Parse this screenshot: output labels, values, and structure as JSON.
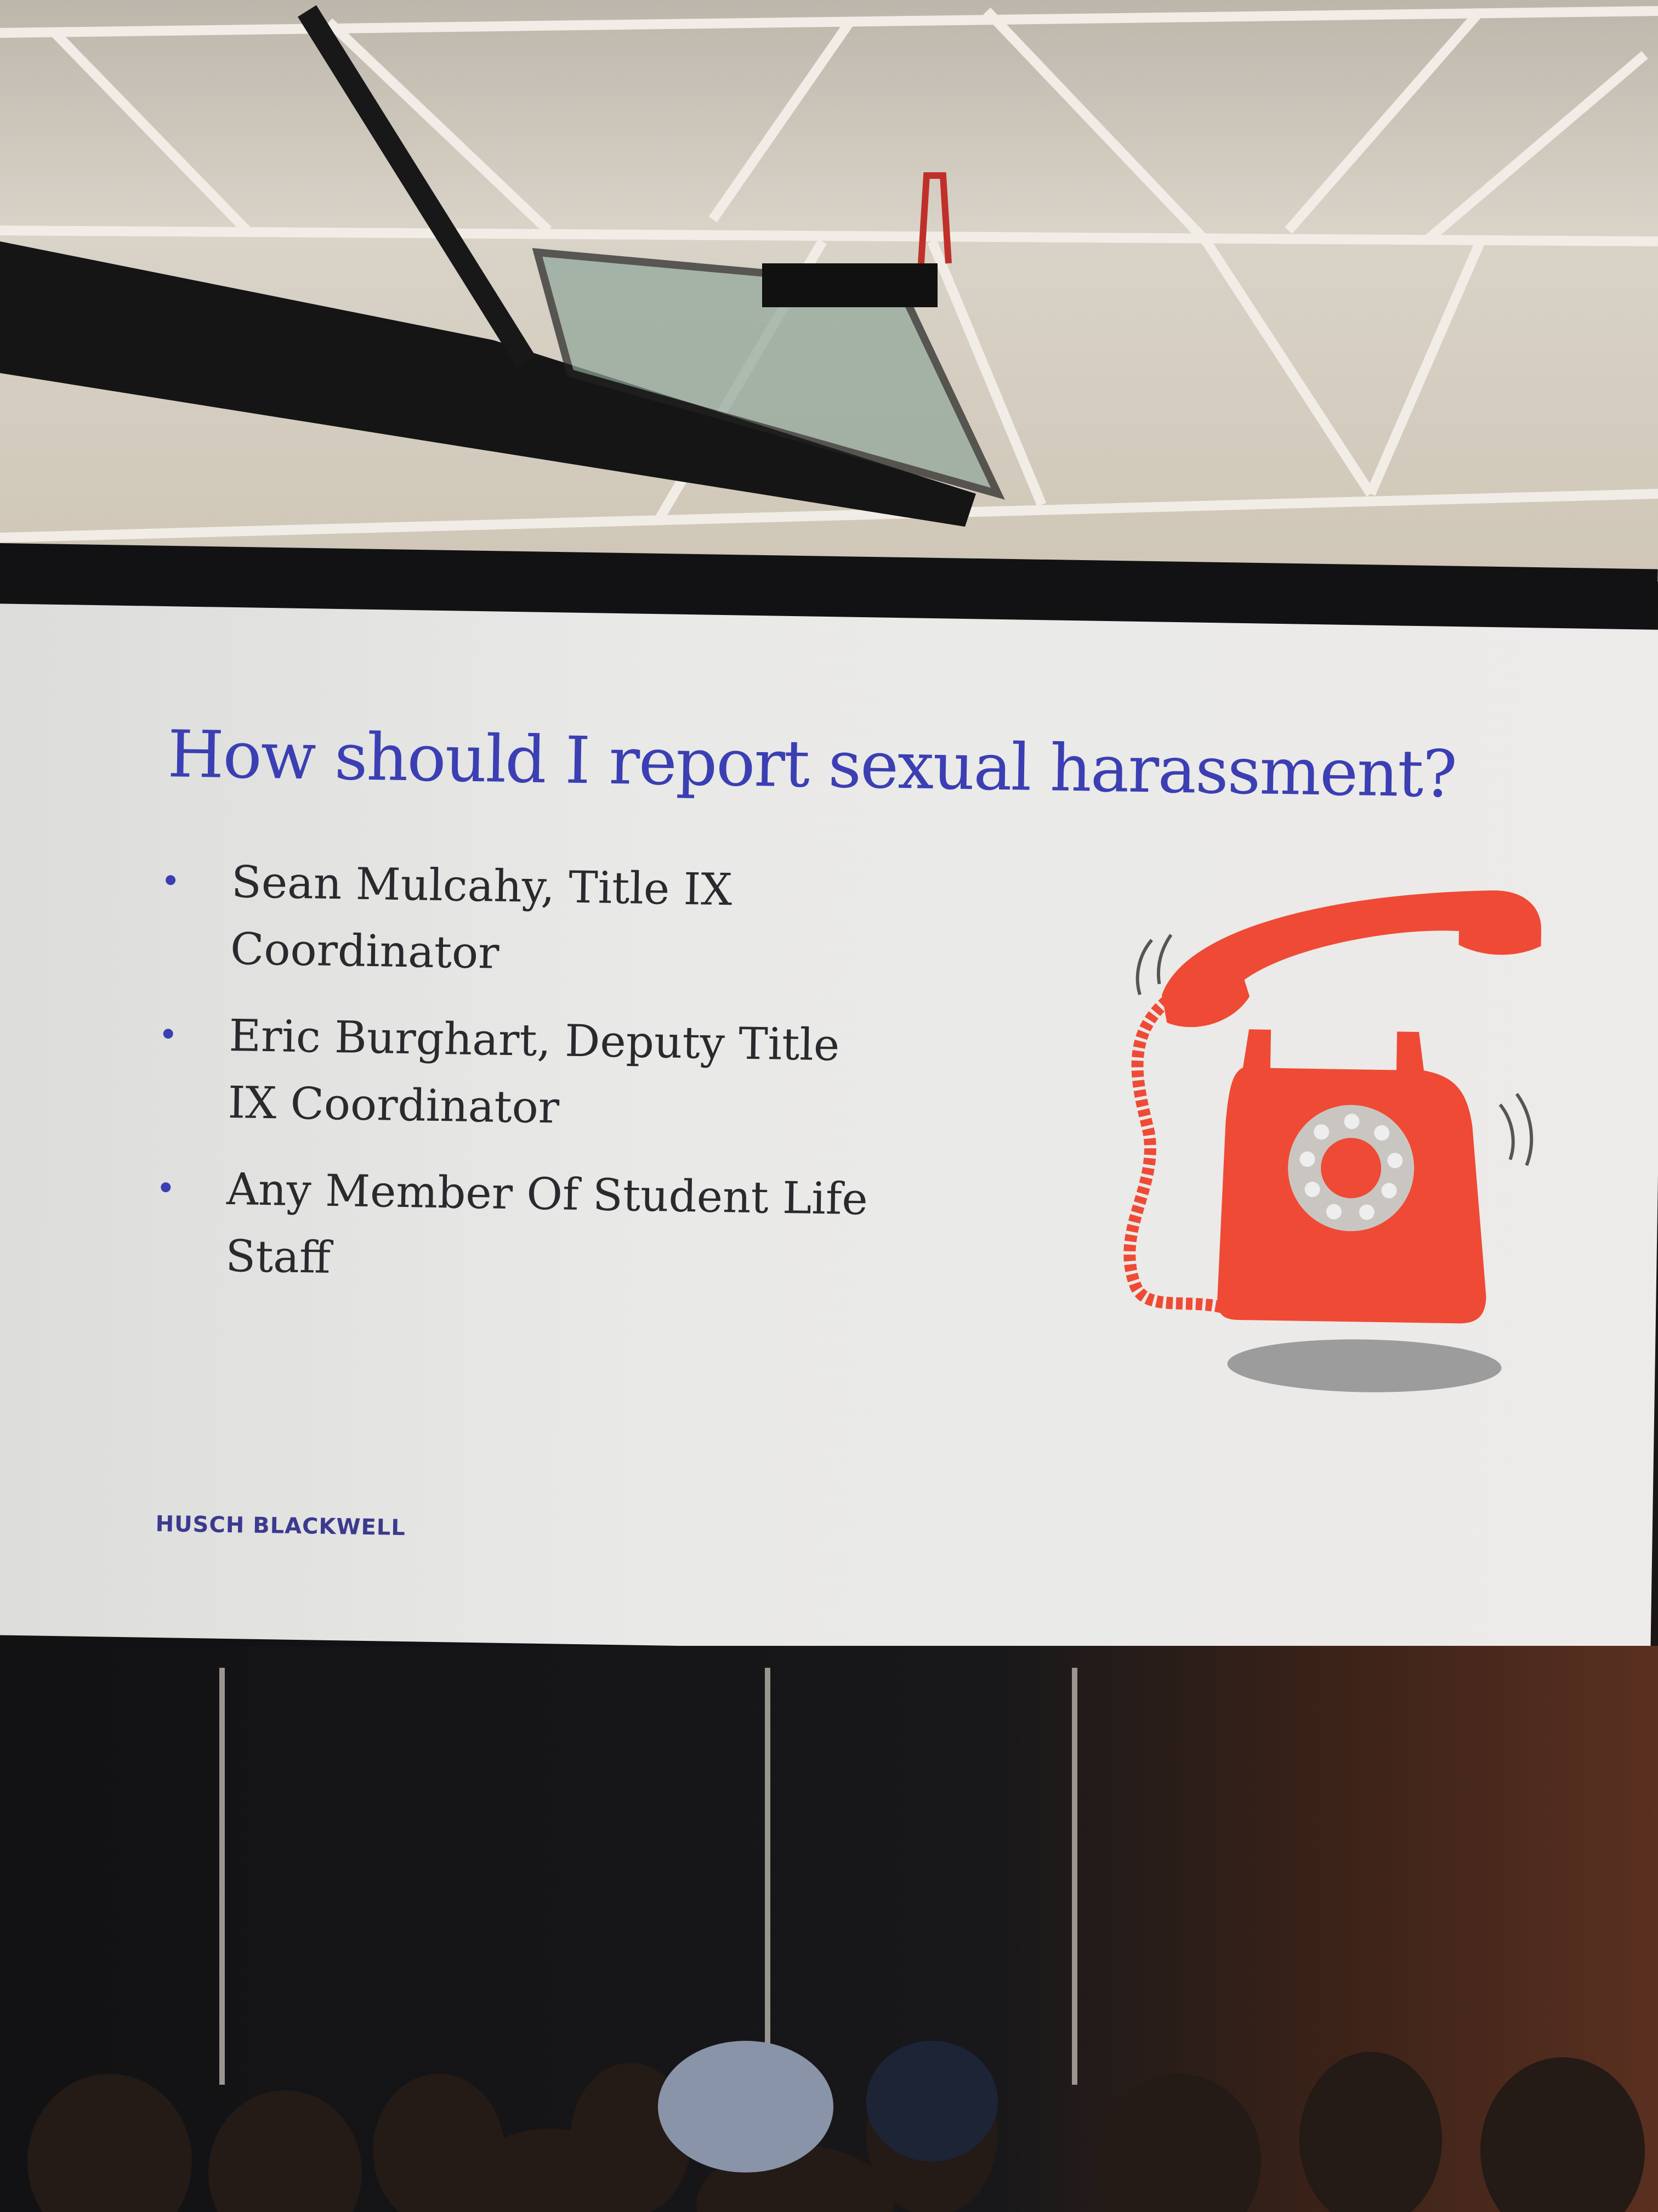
{
  "slide": {
    "title": "How should I report sexual harassment?",
    "bullets": [
      {
        "line1": "Sean Mulcahy, Title IX",
        "line2": "Coordinator"
      },
      {
        "line1": "Eric Burghart, Deputy Title",
        "line2": "IX Coordinator"
      },
      {
        "line1": "Any Member Of Student Life",
        "line2": "Staff"
      }
    ],
    "logo": "HUSCH BLACKWELL",
    "illustration": "ringing-rotary-telephone",
    "colors": {
      "title": "#3b3fb3",
      "phone": "#ef4a35",
      "text": "#2a2a2e"
    }
  }
}
